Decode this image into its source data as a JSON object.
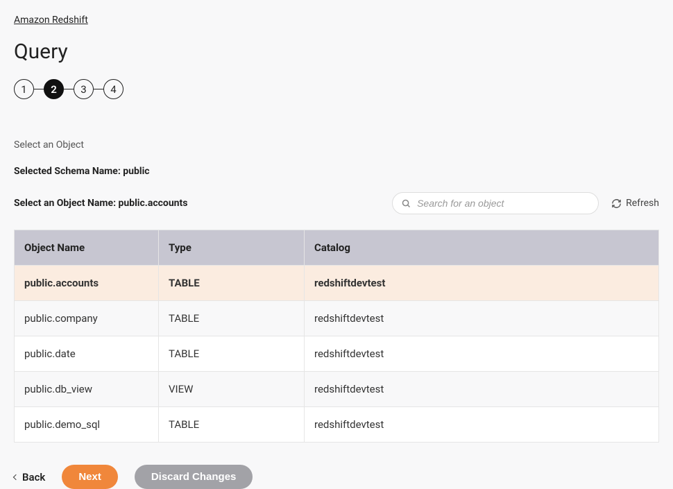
{
  "breadcrumb": "Amazon Redshift",
  "page_title": "Query",
  "stepper": {
    "steps": [
      "1",
      "2",
      "3",
      "4"
    ],
    "active_index": 1
  },
  "section_label": "Select an Object",
  "schema_label": "Selected Schema Name: ",
  "schema_value": "public",
  "object_select_label": "Select an Object Name: ",
  "object_select_value": "public.accounts",
  "search": {
    "placeholder": "Search for an object"
  },
  "refresh_label": "Refresh",
  "table": {
    "columns": [
      "Object Name",
      "Type",
      "Catalog"
    ],
    "rows": [
      {
        "name": "public.accounts",
        "type": "TABLE",
        "catalog": "redshiftdevtest",
        "selected": true
      },
      {
        "name": "public.company",
        "type": "TABLE",
        "catalog": "redshiftdevtest",
        "selected": false
      },
      {
        "name": "public.date",
        "type": "TABLE",
        "catalog": "redshiftdevtest",
        "selected": false
      },
      {
        "name": "public.db_view",
        "type": "VIEW",
        "catalog": "redshiftdevtest",
        "selected": false
      },
      {
        "name": "public.demo_sql",
        "type": "TABLE",
        "catalog": "redshiftdevtest",
        "selected": false
      }
    ]
  },
  "actions": {
    "back": "Back",
    "next": "Next",
    "discard": "Discard Changes"
  },
  "colors": {
    "accent": "#f0873b",
    "secondary": "#a2a2a7",
    "header_bg": "#c7c6d1",
    "selected_row": "#fbece0"
  }
}
